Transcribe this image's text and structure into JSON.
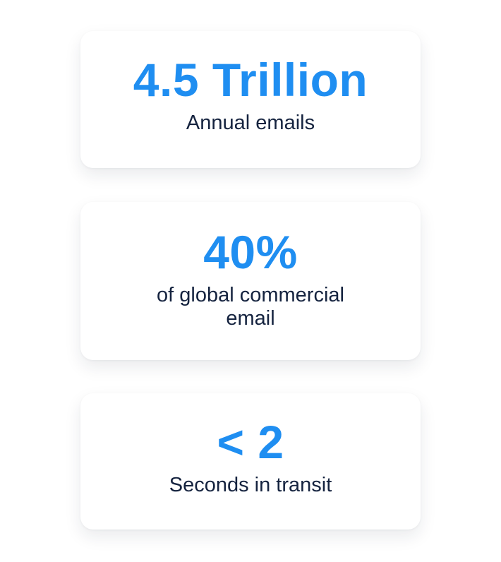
{
  "colors": {
    "accent": "#1f8ef1",
    "text": "#15233f",
    "card_background": "#ffffff"
  },
  "stats": [
    {
      "value": "4.5 Trillion",
      "label": "Annual emails"
    },
    {
      "value": "40%",
      "label": "of global commercial email"
    },
    {
      "value": "< 2",
      "label": "Seconds in transit"
    }
  ]
}
